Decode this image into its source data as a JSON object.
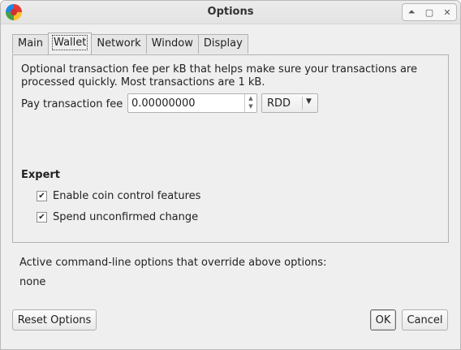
{
  "window": {
    "title": "Options"
  },
  "tabs": [
    {
      "label": "Main"
    },
    {
      "label": "Wallet"
    },
    {
      "label": "Network"
    },
    {
      "label": "Window"
    },
    {
      "label": "Display"
    }
  ],
  "wallet": {
    "description": "Optional transaction fee per kB that helps make sure your transactions are processed quickly. Most transactions are 1 kB.",
    "fee_label": "Pay transaction fee",
    "fee_value": "0.00000000",
    "unit": "RDD",
    "expert_heading": "Expert",
    "coin_control_label": "Enable coin control features",
    "coin_control_checked": true,
    "spend_unconfirmed_label": "Spend unconfirmed change",
    "spend_unconfirmed_checked": true
  },
  "override": {
    "label": "Active command-line options that override above options:",
    "value": "none"
  },
  "buttons": {
    "reset": "Reset Options",
    "ok": "OK",
    "cancel": "Cancel"
  },
  "icons": {
    "check": "✔",
    "spin_up": "▲",
    "spin_down": "▼",
    "dropdown": "▼",
    "wm_up": "⏶",
    "wm_max": "▢",
    "wm_close": "✕"
  },
  "colors": {
    "window_bg": "#efefef",
    "logo_red": "#e53935",
    "logo_green": "#43a047",
    "logo_yellow": "#fbc02d",
    "logo_blue": "#1e88e5"
  }
}
